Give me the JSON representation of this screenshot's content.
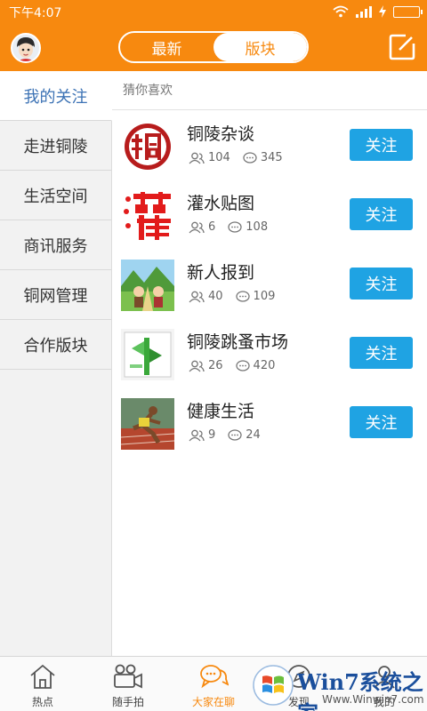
{
  "status_bar": {
    "time": "下午4:07"
  },
  "header": {
    "tabs": [
      {
        "label": "最新",
        "active": false
      },
      {
        "label": "版块",
        "active": true
      }
    ]
  },
  "sidebar": {
    "items": [
      {
        "label": "我的关注",
        "active": true
      },
      {
        "label": "走进铜陵"
      },
      {
        "label": "生活空间"
      },
      {
        "label": "商讯服务"
      },
      {
        "label": "铜网管理"
      },
      {
        "label": "合作版块"
      }
    ]
  },
  "content": {
    "section_title": "猜你喜欢",
    "follow_label": "关注",
    "boards": [
      {
        "name": "铜陵杂谈",
        "members": "104",
        "posts": "345"
      },
      {
        "name": "灌水贴图",
        "members": "6",
        "posts": "108"
      },
      {
        "name": "新人报到",
        "members": "40",
        "posts": "109"
      },
      {
        "name": "铜陵跳蚤市场",
        "members": "26",
        "posts": "420"
      },
      {
        "name": "健康生活",
        "members": "9",
        "posts": "24"
      }
    ]
  },
  "bottom_nav": {
    "items": [
      {
        "label": "热点",
        "icon": "home-icon"
      },
      {
        "label": "随手拍",
        "icon": "camera-icon"
      },
      {
        "label": "大家在聊",
        "icon": "chat-icon",
        "active": true
      },
      {
        "label": "发现",
        "icon": "discover-icon"
      },
      {
        "label": "我的",
        "icon": "profile-icon"
      }
    ]
  },
  "watermark": {
    "title": "Win7系统之家",
    "url": "Www.Winwin7.com"
  },
  "colors": {
    "accent": "#f7890f",
    "follow_button": "#1fa3e3",
    "sidebar_active": "#3d73b5"
  }
}
